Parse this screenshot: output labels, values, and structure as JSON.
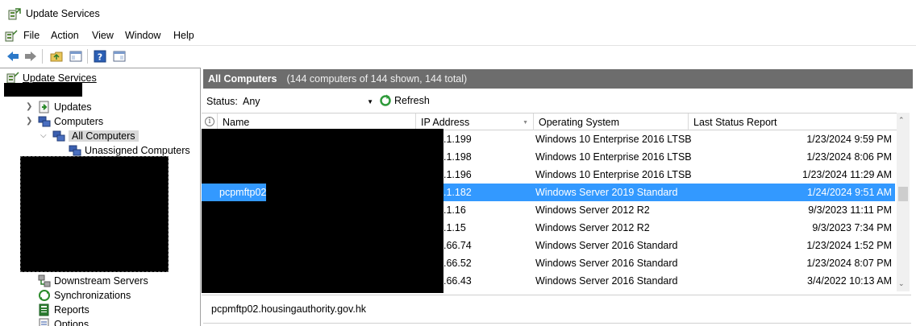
{
  "window": {
    "title": "Update Services"
  },
  "menu": [
    "File",
    "Action",
    "View",
    "Window",
    "Help"
  ],
  "toolbar": [
    "back-icon",
    "forward-icon",
    "up-folder-icon",
    "show-hide-tree-icon",
    "help-icon",
    "console-pane-icon"
  ],
  "tree": {
    "root": "Update Services",
    "updates": "Updates",
    "computers": "Computers",
    "all_computers": "All Computers",
    "unassigned": "Unassigned Computers",
    "downstream": "Downstream Servers",
    "synchronizations": "Synchronizations",
    "reports": "Reports",
    "options": "Options"
  },
  "main": {
    "title": "All Computers",
    "subtitle": "(144 computers of 144 shown, 144 total)",
    "status_label": "Status:",
    "status_value": "Any",
    "refresh_label": "Refresh",
    "columns": {
      "name": "Name",
      "ip": "IP Address",
      "os": "Operating System",
      "report": "Last Status Report"
    },
    "rows": [
      {
        "name": "",
        "ip": ".1.199",
        "os": "Windows 10 Enterprise 2016 LTSB",
        "report": "1/23/2024 9:59 PM"
      },
      {
        "name": "",
        "ip": ".1.198",
        "os": "Windows 10 Enterprise 2016 LTSB",
        "report": "1/23/2024 8:06 PM"
      },
      {
        "name": "",
        "ip": ".1.196",
        "os": "Windows 10 Enterprise 2016 LTSB",
        "report": "1/23/2024 11:29 AM"
      },
      {
        "name": "pcpmftp02",
        "ip": ".1.182",
        "os": "Windows Server 2019 Standard",
        "report": "1/24/2024 9:51 AM"
      },
      {
        "name": "",
        "ip": ".1.16",
        "os": "Windows Server 2012 R2",
        "report": "9/3/2023 11:11 PM"
      },
      {
        "name": "",
        "ip": ".1.15",
        "os": "Windows Server 2012 R2",
        "report": "9/3/2023 7:34 PM"
      },
      {
        "name": "",
        "ip": ".66.74",
        "os": "Windows Server 2016 Standard",
        "report": "1/23/2024 1:52 PM"
      },
      {
        "name": "",
        "ip": ".66.52",
        "os": "Windows Server 2016 Standard",
        "report": "1/23/2024 8:07 PM"
      },
      {
        "name": "",
        "ip": ".66.43",
        "os": "Windows Server 2016 Standard",
        "report": "3/4/2022 10:13 AM"
      }
    ],
    "selected_fqdn": "pcpmftp02.housingauthority.gov.hk"
  },
  "colors": {
    "selection": "#3399ff",
    "header_bar": "#6d6d6d"
  }
}
